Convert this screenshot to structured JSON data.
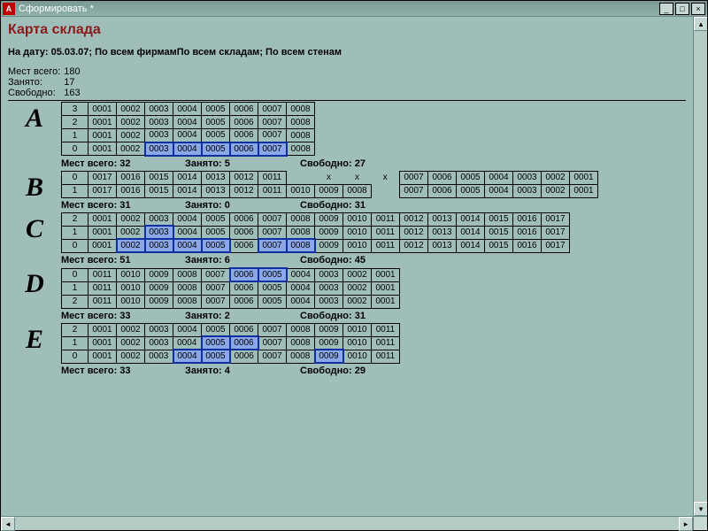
{
  "window": {
    "title": "Сформировать  *"
  },
  "page": {
    "title": "Карта склада",
    "filter_line": "На дату: 05.03.07; По всем фирмамПо всем складам; По всем стенам",
    "summary": {
      "total_label": "Мест всего:",
      "total_value": "180",
      "busy_label": "Занято:",
      "busy_value": "17",
      "free_label": "Свободно:",
      "free_value": "163"
    }
  },
  "stats_labels": {
    "total": "Мест всего:",
    "busy": "Занято:",
    "free": "Свободно:"
  },
  "sections": [
    {
      "letter": "A",
      "rows": [
        {
          "idx": "3",
          "cells": [
            "0001",
            "0002",
            "0003",
            "0004",
            "0005",
            "0006",
            "0007",
            "0008"
          ],
          "hl": []
        },
        {
          "idx": "2",
          "cells": [
            "0001",
            "0002",
            "0003",
            "0004",
            "0005",
            "0006",
            "0007",
            "0008"
          ],
          "hl": []
        },
        {
          "idx": "1",
          "cells": [
            "0001",
            "0002",
            "0003",
            "0004",
            "0005",
            "0006",
            "0007",
            "0008"
          ],
          "hl": []
        },
        {
          "idx": "0",
          "cells": [
            "0001",
            "0002",
            "0003",
            "0004",
            "0005",
            "0006",
            "0007",
            "0008"
          ],
          "hl": [
            2,
            3,
            4,
            5,
            6
          ]
        }
      ],
      "stats": {
        "total": "32",
        "busy": "5",
        "free": "27"
      }
    },
    {
      "letter": "B",
      "rows": [
        {
          "idx": "0",
          "cells": [
            "0017",
            "0016",
            "0015",
            "0014",
            "0013",
            "0012",
            "0011",
            "",
            "x",
            "x",
            "x",
            "0007",
            "0006",
            "0005",
            "0004",
            "0003",
            "0002",
            "0001"
          ],
          "blank": [
            7
          ],
          "plain": [
            8,
            9,
            10
          ]
        },
        {
          "idx": "1",
          "cells": [
            "0017",
            "0016",
            "0015",
            "0014",
            "0013",
            "0012",
            "0011",
            "0010",
            "0009",
            "0008",
            "",
            "0007",
            "0006",
            "0005",
            "0004",
            "0003",
            "0002",
            "0001"
          ],
          "blank": [
            10
          ]
        }
      ],
      "stats": {
        "total": "31",
        "busy": "0",
        "free": "31"
      }
    },
    {
      "letter": "C",
      "rows": [
        {
          "idx": "2",
          "cells": [
            "0001",
            "0002",
            "0003",
            "0004",
            "0005",
            "0006",
            "0007",
            "0008",
            "0009",
            "0010",
            "0011",
            "0012",
            "0013",
            "0014",
            "0015",
            "0016",
            "0017"
          ],
          "hl": []
        },
        {
          "idx": "1",
          "cells": [
            "0001",
            "0002",
            "0003",
            "0004",
            "0005",
            "0006",
            "0007",
            "0008",
            "0009",
            "0010",
            "0011",
            "0012",
            "0013",
            "0014",
            "0015",
            "0016",
            "0017"
          ],
          "hl": [
            2
          ]
        },
        {
          "idx": "0",
          "cells": [
            "0001",
            "0002",
            "0003",
            "0004",
            "0005",
            "0006",
            "0007",
            "0008",
            "0009",
            "0010",
            "0011",
            "0012",
            "0013",
            "0014",
            "0015",
            "0016",
            "0017"
          ],
          "hl": [
            1,
            2,
            3,
            4,
            6,
            7
          ]
        }
      ],
      "stats": {
        "total": "51",
        "busy": "6",
        "free": "45"
      }
    },
    {
      "letter": "D",
      "rows": [
        {
          "idx": "0",
          "cells": [
            "0011",
            "0010",
            "0009",
            "0008",
            "0007",
            "0006",
            "0005",
            "0004",
            "0003",
            "0002",
            "0001"
          ],
          "hl": [
            5,
            6
          ]
        },
        {
          "idx": "1",
          "cells": [
            "0011",
            "0010",
            "0009",
            "0008",
            "0007",
            "0006",
            "0005",
            "0004",
            "0003",
            "0002",
            "0001"
          ],
          "hl": []
        },
        {
          "idx": "2",
          "cells": [
            "0011",
            "0010",
            "0009",
            "0008",
            "0007",
            "0006",
            "0005",
            "0004",
            "0003",
            "0002",
            "0001"
          ],
          "hl": []
        }
      ],
      "stats": {
        "total": "33",
        "busy": "2",
        "free": "31"
      }
    },
    {
      "letter": "E",
      "rows": [
        {
          "idx": "2",
          "cells": [
            "0001",
            "0002",
            "0003",
            "0004",
            "0005",
            "0006",
            "0007",
            "0008",
            "0009",
            "0010",
            "0011"
          ],
          "hl": []
        },
        {
          "idx": "1",
          "cells": [
            "0001",
            "0002",
            "0003",
            "0004",
            "0005",
            "0006",
            "0007",
            "0008",
            "0009",
            "0010",
            "0011"
          ],
          "hl": [
            4,
            5
          ]
        },
        {
          "idx": "0",
          "cells": [
            "0001",
            "0002",
            "0003",
            "0004",
            "0005",
            "0006",
            "0007",
            "0008",
            "0009",
            "0010",
            "0011"
          ],
          "hl": [
            3,
            4,
            8
          ]
        }
      ],
      "stats": {
        "total": "33",
        "busy": "4",
        "free": "29"
      }
    }
  ]
}
